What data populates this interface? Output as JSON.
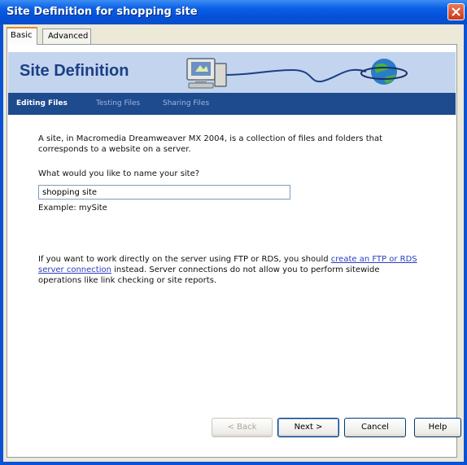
{
  "window": {
    "title": "Site Definition for shopping site"
  },
  "tabs": [
    {
      "label": "Basic"
    },
    {
      "label": "Advanced"
    }
  ],
  "banner": {
    "title": "Site Definition"
  },
  "steps": [
    {
      "label": "Editing Files"
    },
    {
      "label": "Testing Files"
    },
    {
      "label": "Sharing Files"
    }
  ],
  "content": {
    "intro": "A site, in Macromedia Dreamweaver MX 2004, is a collection of files and folders that corresponds to a website on a server.",
    "question": "What would you like to name your site?",
    "site_name_value": "shopping site",
    "example": "Example: mySite",
    "server_text_before": "If you want to work directly on the server using FTP or RDS, you should ",
    "server_link": "create an FTP or RDS server connection",
    "server_text_after": " instead. Server connections do not allow you to perform sitewide operations like link checking or site reports."
  },
  "buttons": {
    "back": "< Back",
    "next": "Next >",
    "cancel": "Cancel",
    "help": "Help"
  }
}
